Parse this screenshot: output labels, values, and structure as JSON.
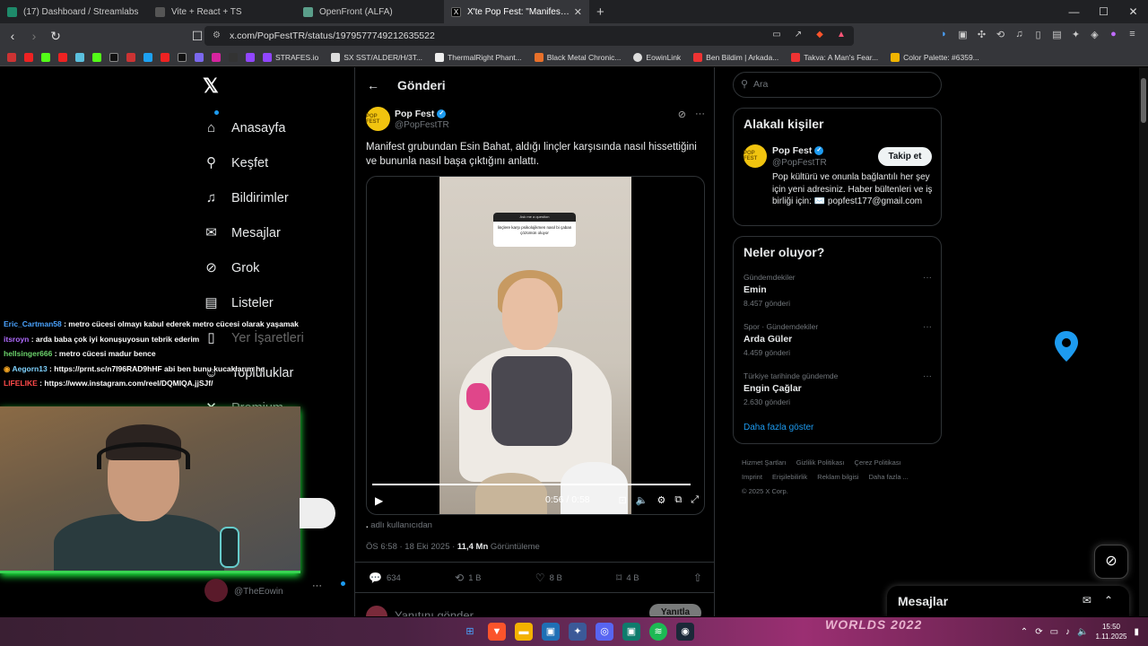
{
  "tabs": [
    {
      "title": "(17) Dashboard / Streamlabs",
      "icon": "streamlabs-icon",
      "color": "#1e8a6a"
    },
    {
      "title": "Vite + React + TS",
      "icon": "globe-icon",
      "color": "#888888"
    },
    {
      "title": "OpenFront (ALFA)",
      "icon": "globe-icon",
      "color": "#5a9e8a"
    },
    {
      "title": "X'te Pop Fest: \"Manifest grubunc",
      "icon": "x-icon",
      "color": "#000000",
      "active": true
    }
  ],
  "url": "x.com/PopFestTR/status/1979577749212635522",
  "bookmarks": [
    {
      "label": "STRAFES.io"
    },
    {
      "label": "SX SST/ALDER/H/3T..."
    },
    {
      "label": "ThermalRight Phant..."
    },
    {
      "label": "Black Metal Chronic..."
    },
    {
      "label": "EowinLink"
    },
    {
      "label": "Ben Bildim | Arkada..."
    },
    {
      "label": "Takva: A Man's Fear..."
    },
    {
      "label": "Color Palette: #6359..."
    }
  ],
  "nav": {
    "logo": "𝕏",
    "items": [
      {
        "label": "Anasayfa",
        "icon": "home-icon",
        "glyph": "⌂"
      },
      {
        "label": "Keşfet",
        "icon": "search-icon",
        "glyph": "⚲"
      },
      {
        "label": "Bildirimler",
        "icon": "bell-icon",
        "glyph": "🔔"
      },
      {
        "label": "Mesajlar",
        "icon": "mail-icon",
        "glyph": "✉"
      },
      {
        "label": "Grok",
        "icon": "grok-icon",
        "glyph": "⊘"
      },
      {
        "label": "Listeler",
        "icon": "list-icon",
        "glyph": "▤"
      },
      {
        "label": "Yer İşaretleri",
        "icon": "bookmark-icon",
        "glyph": "🔖"
      },
      {
        "label": "Topluluklar",
        "icon": "communities-icon",
        "glyph": "👥"
      },
      {
        "label": "Premium",
        "icon": "premium-icon",
        "glyph": "✕"
      }
    ]
  },
  "post": {
    "header": "Gönderi",
    "author_name": "Pop Fest",
    "author_handle": "@PopFestTR",
    "avatar_text": "POP FEST",
    "text": "Manifest grubundan Esin Bahat, aldığı linçler karşısında nasıl hissettiğini ve bununla nasıl başa çıktığını anlattı.",
    "video_question_title": "Ask me a question",
    "video_question_text": "linçlere karşı psikolojikmen nasıl bi çaban çözümün oluyor",
    "video_time": "0:56 / 0:58",
    "video_progress": 0.97,
    "caption_prefix": ".",
    "caption": "adlı kullanıcıdan",
    "time": "ÖS 6:58 · 18 Eki 2025 · ",
    "views": "11,4 Mn",
    "views_label": " Görüntüleme",
    "replies": "634",
    "reposts": "1 B",
    "likes": "8 B",
    "bookmarks": "4 B",
    "reply_placeholder": "Yanıtını gönder",
    "reply_button": "Yanıtla"
  },
  "sidebar": {
    "search_placeholder": "Ara",
    "related_title": "Alakalı kişiler",
    "related": {
      "name": "Pop Fest",
      "handle": "@PopFestTR",
      "follow": "Takip et",
      "bio": "Pop kültürü ve onunla bağlantılı her şey için yeni adresiniz. Haber bültenleri ve iş birliği için: ✉️ popfest177@gmail.com"
    },
    "trends_title": "Neler oluyor?",
    "trends": [
      {
        "context": "Gündemdekiler",
        "name": "Emin",
        "posts": "8.457 gönderi"
      },
      {
        "context": "Spor · Gündemdekiler",
        "name": "Arda Güler",
        "posts": "4.459 gönderi"
      },
      {
        "context": "Türkiye tarihinde gündemde",
        "name": "Engin Çağlar",
        "posts": "2.630 gönderi"
      }
    ],
    "show_more": "Daha fazla göster",
    "footer": [
      "Hizmet Şartları",
      "Gizlilik Politikası",
      "Çerez Politikası",
      "Imprint",
      "Erişilebilirlik",
      "Reklam bilgisi",
      "Daha fazla ...",
      "© 2025 X Corp."
    ]
  },
  "messages_drawer": {
    "title": "Mesajlar"
  },
  "chat": [
    {
      "user": "Eric_Cartman58",
      "color": "#4aa3ff",
      "text": "metro cücesi olmayı kabul ederek metro cücesi olarak yaşamak"
    },
    {
      "user": "itsroyn",
      "color": "#b06bff",
      "text": "arda baba çok iyi konuşuyosun tebrik ederim"
    },
    {
      "user": "hellsinger666",
      "color": "#6bd36b",
      "text": "metro cücesi madur bence"
    },
    {
      "user": "Aegorn13",
      "color": "#7fd3ff",
      "text": "https://prnt.sc/n7I96RAD9hHF abi ben bunu kucaklarım he"
    },
    {
      "user": "LIFELIKE",
      "color": "#ff4a4a",
      "text": "https://www.instagram.com/reel/DQMIQA.jjSJf/"
    }
  ],
  "stream_user": {
    "handle": "@TheEowin"
  },
  "taskbar": {
    "art": "WORLDS 2022",
    "time": "15:50",
    "date": "1.11.2025"
  }
}
